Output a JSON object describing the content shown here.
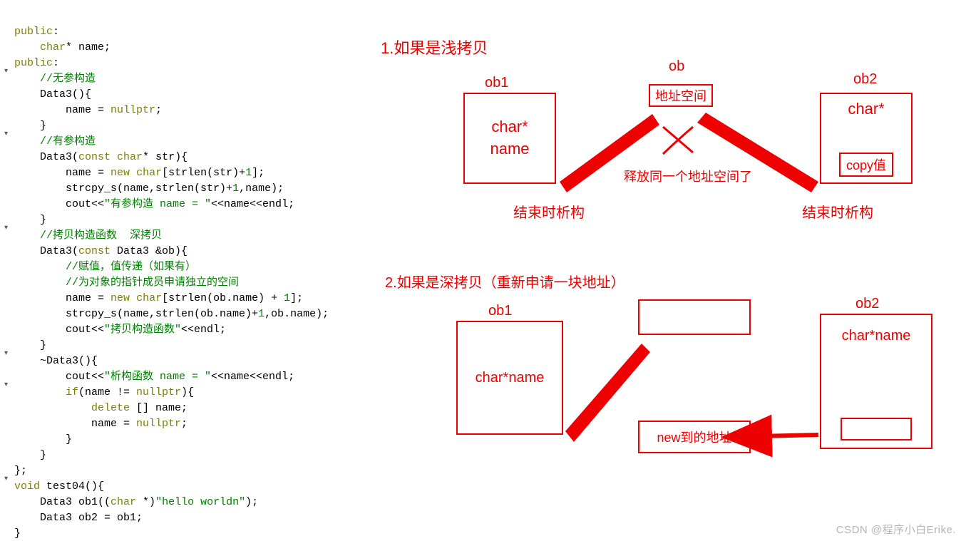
{
  "code": {
    "l01": "public",
    "l02": "char",
    "l02b": "* name;",
    "l03": "public",
    "cm1": "//无参构造",
    "l04": "    Data3(){",
    "l05a": "        name = ",
    "l05b": "nullptr",
    "l05c": ";",
    "l06": "    }",
    "cm2": "//有参构造",
    "l07a": "    Data3(",
    "l07b": "const",
    "l07c": " ",
    "l07d": "char",
    "l07e": "* str){",
    "l08a": "        name = ",
    "l08b": "new",
    "l08c": " ",
    "l08d": "char",
    "l08e": "[strlen(str)+",
    "l08f": "1",
    "l08g": "];",
    "l09a": "        strcpy_s(name,strlen(str)+",
    "l09b": "1",
    "l09c": ",name);",
    "l10a": "        cout<<",
    "l10b": "\"有参构造 name = \"",
    "l10c": "<<name<<endl;",
    "l11": "    }",
    "cm3": "//拷贝构造函数  深拷贝",
    "l12a": "    Data3(",
    "l12b": "const",
    "l12c": " Data3 &ob){",
    "cm4": "//赋值，值传递（如果有）",
    "cm5": "//为对象的指针成员申请独立的空间",
    "l13a": "        name = ",
    "l13b": "new",
    "l13c": " ",
    "l13d": "char",
    "l13e": "[strlen(ob.name) + ",
    "l13f": "1",
    "l13g": "];",
    "l14a": "        strcpy_s(name,strlen(ob.name)+",
    "l14b": "1",
    "l14c": ",ob.name);",
    "l15a": "        cout<<",
    "l15b": "\"拷贝构造函数\"",
    "l15c": "<<endl;",
    "l16": "    }",
    "l17": "    ~Data3(){",
    "l18a": "        cout<<",
    "l18b": "\"析构函数 name = \"",
    "l18c": "<<name<<endl;",
    "l19a": "        ",
    "l19b": "if",
    "l19c": "(name != ",
    "l19d": "nullptr",
    "l19e": "){",
    "l20a": "            ",
    "l20b": "delete",
    "l20c": " [] name;",
    "l21a": "            name = ",
    "l21b": "nullptr",
    "l21c": ";",
    "l22": "        }",
    "l23": "    }",
    "l24": "};",
    "l25a": "void",
    "l25b": " test04(){",
    "l26a": "    Data3 ob1((",
    "l26b": "char",
    "l26c": " *)",
    "l26d": "\"hello worldn\"",
    "l26e": ");",
    "l27": "    Data3 ob2 = ob1;",
    "l28": "}"
  },
  "diagram": {
    "title1": "1.如果是浅拷贝",
    "ob1_label_top": "ob1",
    "ob_label_top": "ob",
    "ob2_label_top": "ob2",
    "addr_space": "地址空间",
    "char_star": "char*",
    "name_word": "name",
    "copy_val": "copy值",
    "x_note": "释放同一个地址空间了",
    "end_destruct": "结束时析构",
    "title2": "2.如果是深拷贝（重新申请一块地址）",
    "ob1_label_bot": "ob1",
    "ob2_label_bot": "ob2",
    "char_star_name": "char*name",
    "new_addr": "new到的地址"
  },
  "watermark": "CSDN @程序小白Erike."
}
